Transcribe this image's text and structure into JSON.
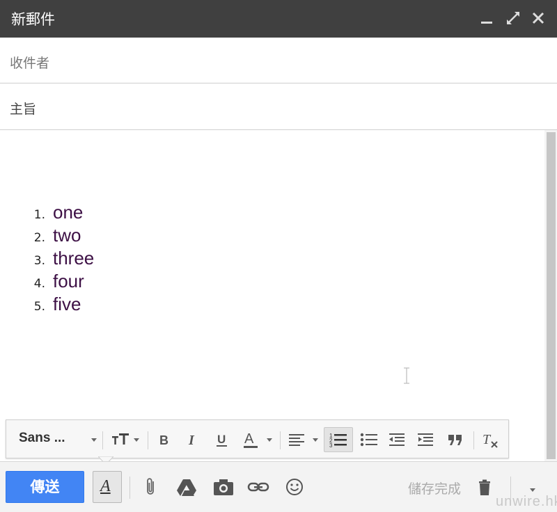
{
  "window": {
    "title": "新郵件"
  },
  "fields": {
    "to_placeholder": "收件者",
    "subject_placeholder": "主旨"
  },
  "body": {
    "list": [
      {
        "num": "1.",
        "text": "one"
      },
      {
        "num": "2.",
        "text": "two"
      },
      {
        "num": "3.",
        "text": "three"
      },
      {
        "num": "4.",
        "text": "four"
      },
      {
        "num": "5.",
        "text": "five"
      }
    ]
  },
  "toolbar": {
    "font_family": "Sans ..."
  },
  "actions": {
    "send_label": "傳送",
    "saved_status": "儲存完成"
  },
  "watermark": "unwire.hk",
  "colors": {
    "titlebar": "#404040",
    "send": "#4285f4",
    "list_text": "#3d1045"
  }
}
